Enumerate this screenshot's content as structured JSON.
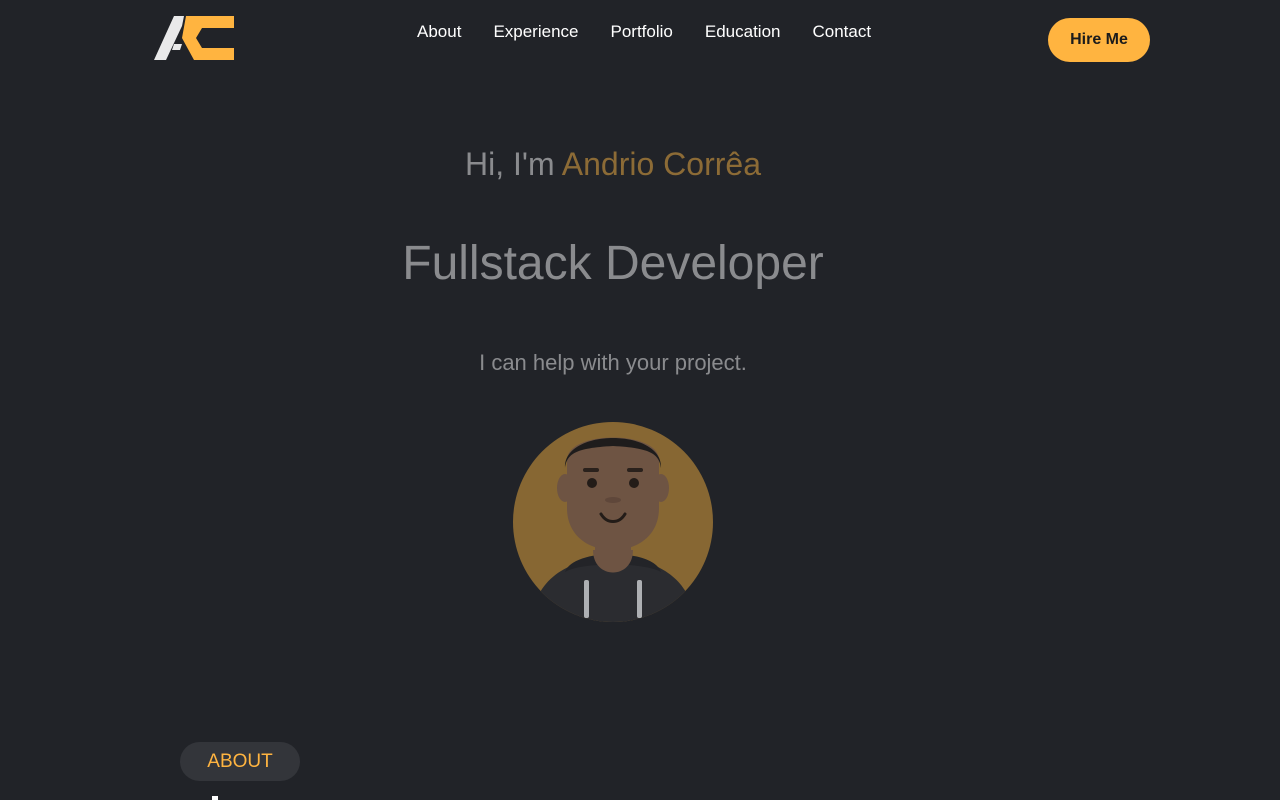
{
  "header": {
    "logo_icon": "ac-monogram-logo",
    "nav": [
      {
        "label": "About"
      },
      {
        "label": "Experience"
      },
      {
        "label": "Portfolio"
      },
      {
        "label": "Education"
      },
      {
        "label": "Contact"
      }
    ],
    "hire_label": "Hire Me"
  },
  "hero": {
    "greeting_prefix": "Hi, I'm ",
    "name": "Andrio Corrêa",
    "role": "Fullstack Developer",
    "tagline": "I can help with your project.",
    "avatar_icon": "developer-avatar-illustration"
  },
  "about": {
    "tag": "ABOUT"
  },
  "colors": {
    "background": "#212328",
    "accent": "#ffb440",
    "muted_text": "#8a8b8e",
    "name_highlight": "#8c6b36",
    "tag_background": "#33353a"
  }
}
